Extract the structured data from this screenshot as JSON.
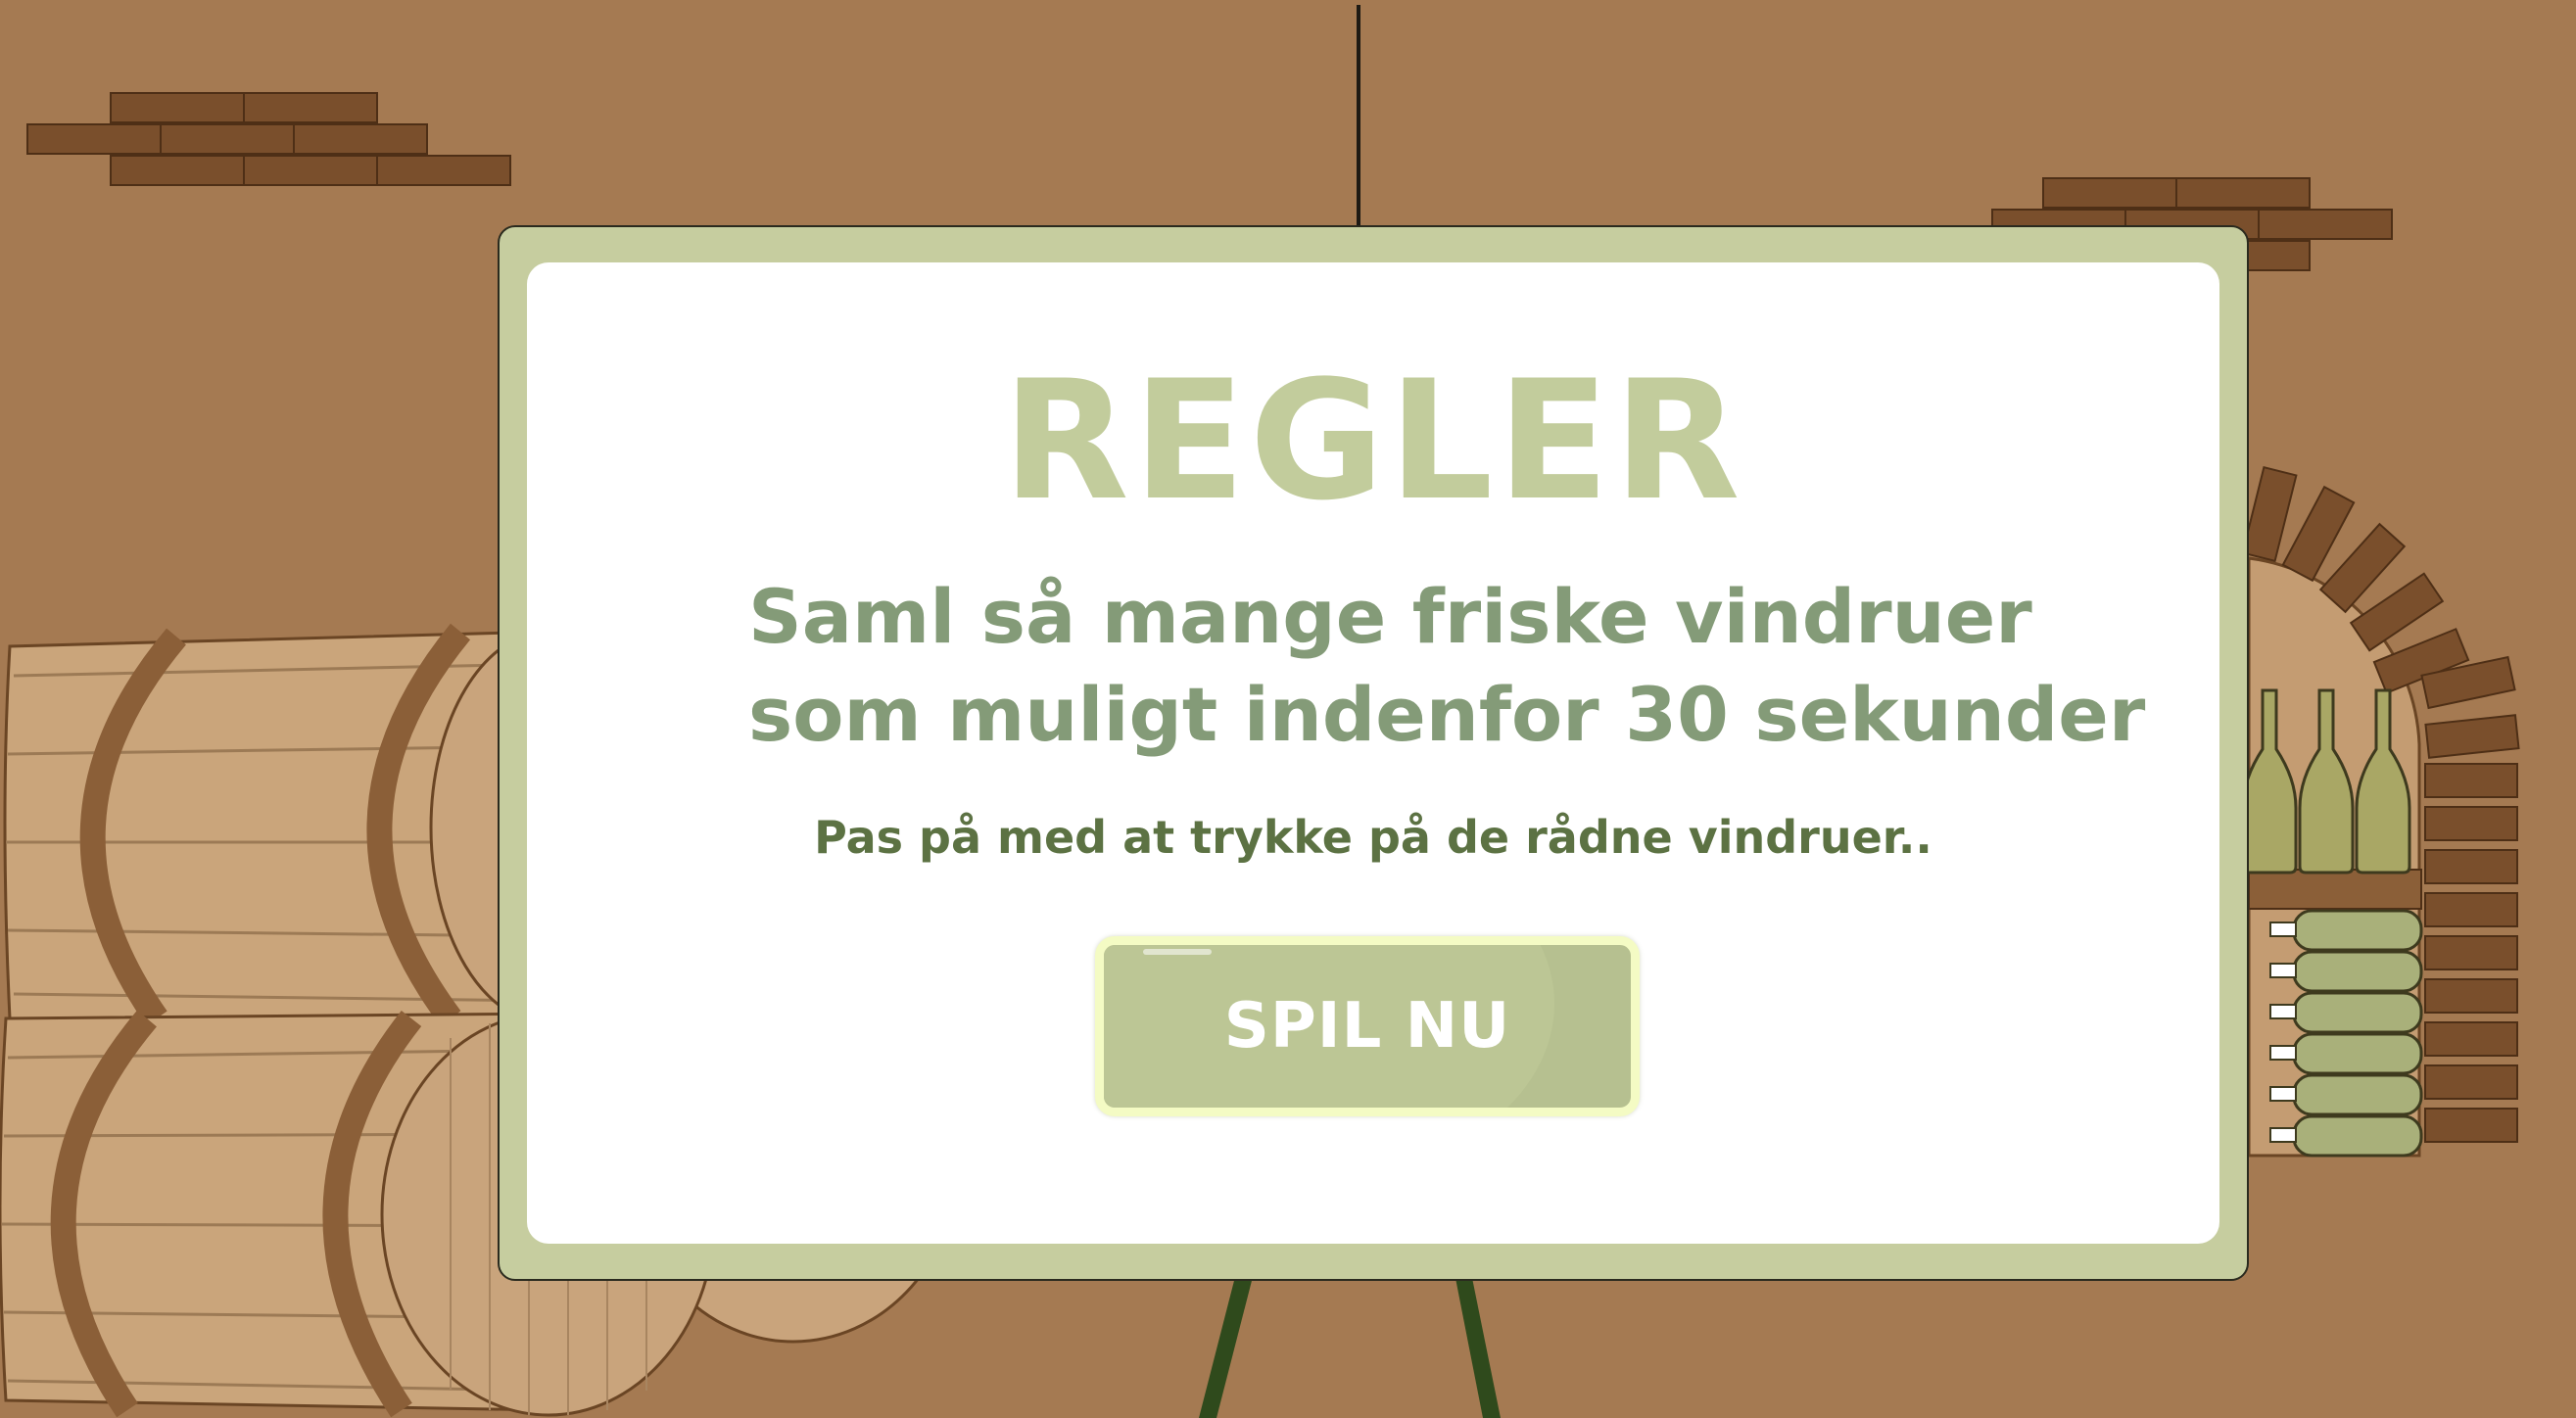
{
  "modal": {
    "title": "REGLER",
    "instruction_lines": [
      "Saml så mange friske vindruer",
      "som muligt indenfor 30 sekunder"
    ],
    "warning": "Pas på med at trykke på de rådne vindruer..",
    "play_button_label": "SPIL NU"
  },
  "colors": {
    "wall": "#a57a52",
    "brick": "#7a4f2c",
    "board_frame": "#c6cd9f",
    "title": "#c2cc9c",
    "instruction": "#849b78",
    "warning": "#5c7243",
    "button": "#b6c090"
  }
}
